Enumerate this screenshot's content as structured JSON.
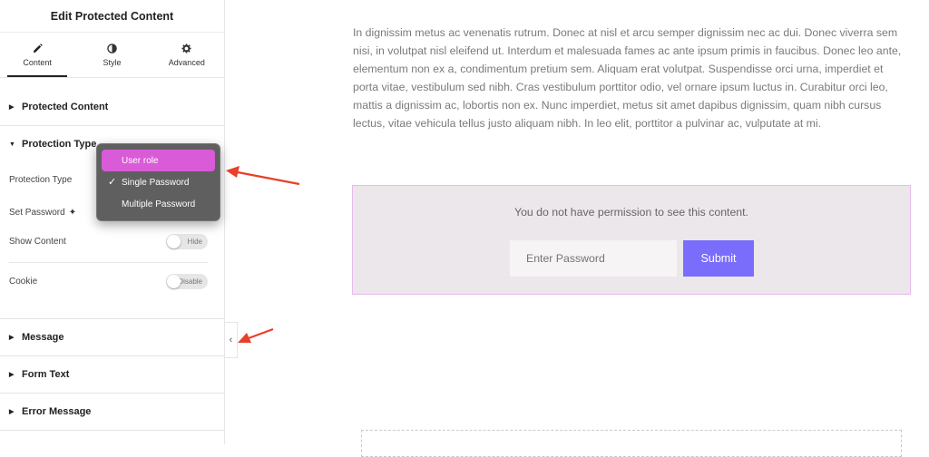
{
  "panel": {
    "title": "Edit Protected Content",
    "tabs": [
      {
        "label": "Content",
        "icon": "pencil-icon"
      },
      {
        "label": "Style",
        "icon": "contrast-icon"
      },
      {
        "label": "Advanced",
        "icon": "gear-icon"
      }
    ],
    "sections": {
      "protected_content": "Protected Content",
      "protection_type": "Protection Type",
      "message": "Message",
      "form_text": "Form Text",
      "error_message": "Error Message"
    },
    "controls": {
      "protection_type_label": "Protection Type",
      "set_password_label": "Set Password",
      "show_content_label": "Show Content",
      "show_content_toggle": "Hide",
      "cookie_label": "Cookie",
      "cookie_toggle": "Disable"
    },
    "dropdown": {
      "options": [
        "User role",
        "Single Password",
        "Multiple Password"
      ],
      "highlighted": "User role",
      "selected": "Single Password"
    }
  },
  "main": {
    "paragraph": "In dignissim metus ac venenatis rutrum. Donec at nisl et arcu semper dignissim nec ac dui. Donec viverra sem nisi, in volutpat nisl eleifend ut. Interdum et malesuada fames ac ante ipsum primis in faucibus. Donec leo ante, elementum non ex a, condimentum pretium sem. Aliquam erat volutpat. Suspendisse orci urna, imperdiet et porta vitae, vestibulum sed nibh. Cras vestibulum porttitor odio, vel ornare ipsum luctus in. Curabitur orci leo, mattis a dignissim ac, lobortis non ex. Nunc imperdiet, metus sit amet dapibus dignissim, quam nibh cursus lectus, vitae vehicula tellus justo aliquam nibh. In leo elit, porttitor a pulvinar ac, vulputate at mi.",
    "permission_text": "You do not have permission to see this content.",
    "password_placeholder": "Enter Password",
    "submit_label": "Submit"
  },
  "colors": {
    "highlight": "#d95bd8",
    "submit": "#7a6dfb",
    "annotation_arrow": "#e8402a",
    "box_border": "#eab7ee"
  }
}
